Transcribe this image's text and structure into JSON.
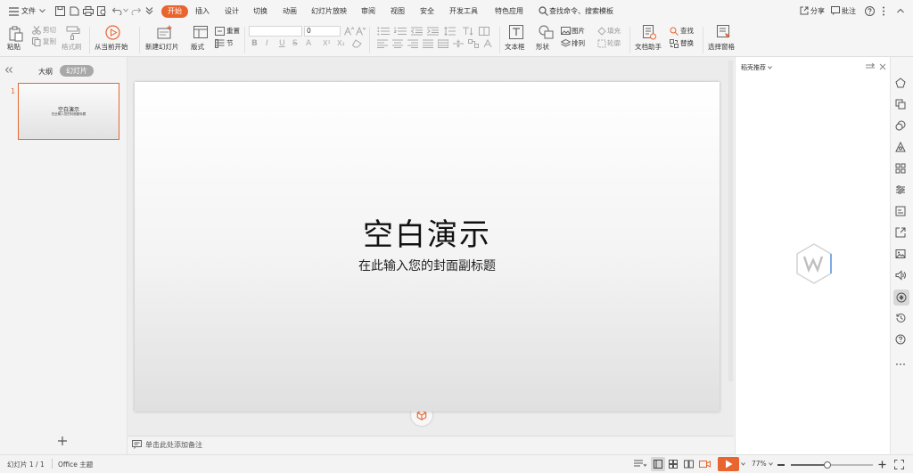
{
  "menubar": {
    "file_label": "文件",
    "tabs": [
      "开始",
      "插入",
      "设计",
      "切换",
      "动画",
      "幻灯片放映",
      "审阅",
      "视图",
      "安全",
      "开发工具",
      "特色应用"
    ],
    "search_label": "查找命令、搜索模板",
    "share_label": "分享",
    "comment_label": "批注"
  },
  "toolbar": {
    "paste": "粘贴",
    "cut": "剪切",
    "copy": "复制",
    "format_painter": "格式刷",
    "from_current": "从当前开始",
    "new_slide": "新建幻灯片",
    "layout": "版式",
    "reset": "重置",
    "section": "节",
    "font_size": "0",
    "textbox": "文本框",
    "shape": "形状",
    "picture": "图片",
    "fill": "填充",
    "arrange": "排列",
    "outline": "轮廓",
    "doc_assistant": "文档助手",
    "find": "查找",
    "replace": "替换",
    "select_pane": "选择窗格"
  },
  "leftpane": {
    "tab_outline": "大纲",
    "tab_slides": "幻灯片",
    "slide_number": "1",
    "thumb_title": "空白演示",
    "thumb_subtitle": "在此输入您的封面副标题"
  },
  "slide": {
    "title": "空白演示",
    "subtitle": "在此输入您的封面副标题"
  },
  "notes_placeholder": "单击此处添加备注",
  "rightpanel": {
    "title": "稻壳推荐"
  },
  "statusbar": {
    "slide_count": "幻灯片 1 / 1",
    "theme": "Office 主题",
    "zoom": "77%",
    "zoom_fraction": 0.45
  },
  "colors": {
    "accent": "#e8652f"
  }
}
